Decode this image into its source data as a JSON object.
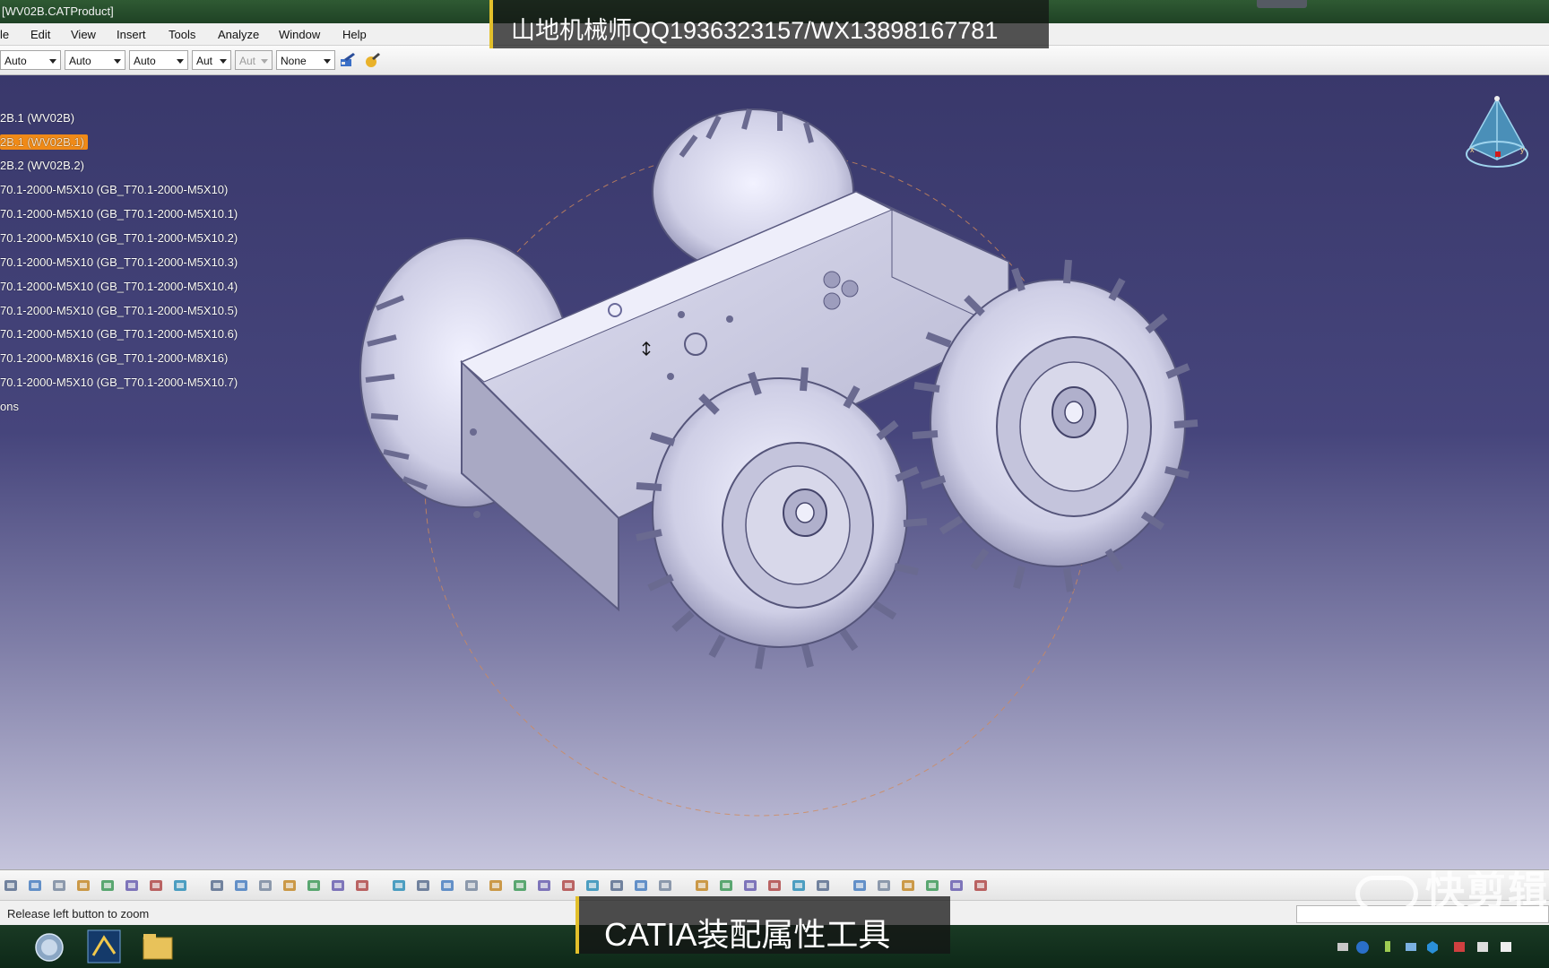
{
  "window": {
    "title": "[WV02B.CATProduct]"
  },
  "menu": [
    "le",
    "Edit",
    "View",
    "Insert",
    "Tools",
    "Analyze",
    "Window",
    "Help"
  ],
  "toolbar": {
    "combos": [
      {
        "value": "Auto",
        "enabled": true
      },
      {
        "value": "Auto",
        "enabled": true
      },
      {
        "value": "Auto",
        "enabled": true
      },
      {
        "value": "Aut",
        "enabled": true
      },
      {
        "value": "Aut",
        "enabled": false
      },
      {
        "value": "None",
        "enabled": true
      }
    ],
    "icons": [
      "painter-icon",
      "material-icon"
    ]
  },
  "tree": {
    "nodes": [
      {
        "label": "2B.1 (WV02B)",
        "selected": false
      },
      {
        "label": "2B.1 (WV02B.1)",
        "selected": true
      },
      {
        "label": "2B.2 (WV02B.2)",
        "selected": false
      },
      {
        "label": "70.1-2000-M5X10 (GB_T70.1-2000-M5X10)",
        "selected": false
      },
      {
        "label": "70.1-2000-M5X10 (GB_T70.1-2000-M5X10.1)",
        "selected": false
      },
      {
        "label": "70.1-2000-M5X10 (GB_T70.1-2000-M5X10.2)",
        "selected": false
      },
      {
        "label": "70.1-2000-M5X10 (GB_T70.1-2000-M5X10.3)",
        "selected": false
      },
      {
        "label": "70.1-2000-M5X10 (GB_T70.1-2000-M5X10.4)",
        "selected": false
      },
      {
        "label": "70.1-2000-M5X10 (GB_T70.1-2000-M5X10.5)",
        "selected": false
      },
      {
        "label": "70.1-2000-M5X10 (GB_T70.1-2000-M5X10.6)",
        "selected": false
      },
      {
        "label": "70.1-2000-M8X16 (GB_T70.1-2000-M8X16)",
        "selected": false
      },
      {
        "label": "70.1-2000-M5X10 (GB_T70.1-2000-M5X10.7)",
        "selected": false
      },
      {
        "label": "ons",
        "selected": false
      }
    ]
  },
  "compass": {
    "axes": [
      "x",
      "y"
    ]
  },
  "bottom_toolbar": {
    "icons": [
      "new-icon",
      "print-icon",
      "cut-icon",
      "copy-icon",
      "paste-icon",
      "undo-icon",
      "redo-icon",
      "whats-this-icon",
      "formula-icon",
      "comment-icon",
      "link-icon",
      "table-icon",
      "tree-icon",
      "catalog-icon",
      "knowledge-icon",
      "fly-icon",
      "fit-all-icon",
      "pan-icon",
      "rotate-icon",
      "zoom-in-icon",
      "zoom-out-icon",
      "normal-view-icon",
      "multi-view-icon",
      "iso-view-icon",
      "shading-icon",
      "hide-show-icon",
      "swap-icon",
      "measure-icon",
      "capture-icon",
      "snapshot-icon",
      "distance-icon",
      "clash-icon",
      "inertia-icon",
      "update-icon",
      "section-icon",
      "render-icon",
      "material-icon",
      "apply-material-icon",
      "grid-icon"
    ]
  },
  "status": {
    "message": "Release left button to zoom"
  },
  "overlays": {
    "top_caption": "山地机械师QQ1936323157/WX13898167781",
    "bottom_caption": "CATIA装配属性工具",
    "watermark": "快剪辑"
  },
  "colors": {
    "selection": "#f08a17",
    "caption_accent": "#e3c02b",
    "model_fill": "#d6d6ea"
  }
}
